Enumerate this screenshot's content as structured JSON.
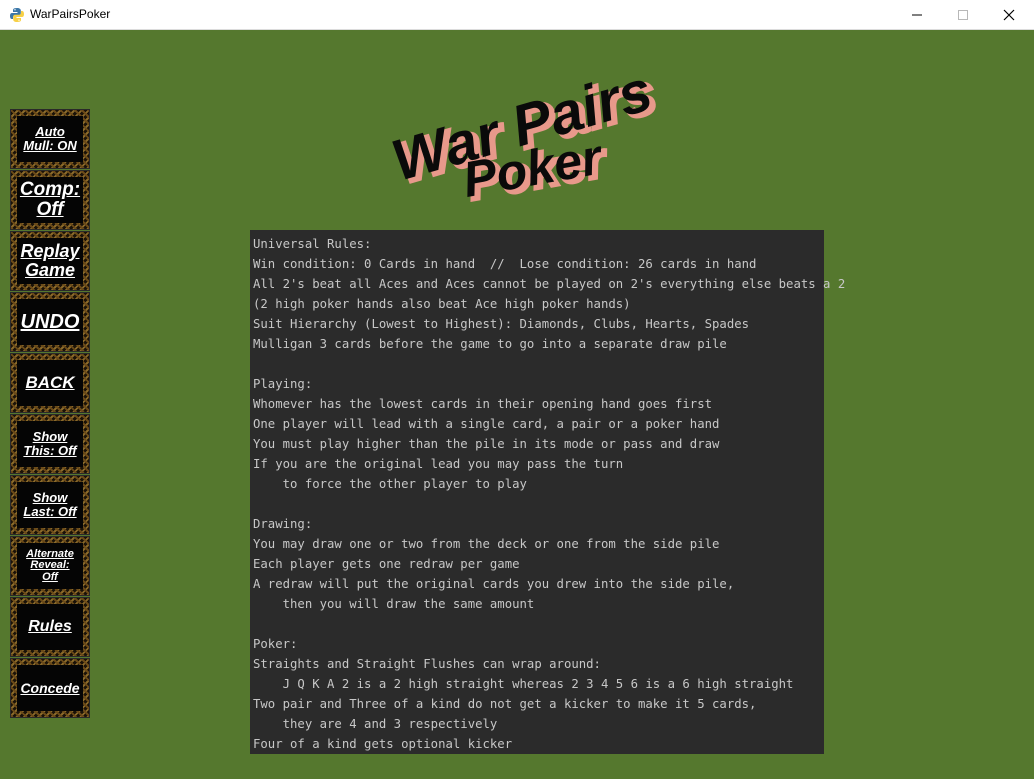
{
  "window": {
    "title": "WarPairsPoker",
    "icon": "python-icon",
    "controls": [
      "minimize-icon",
      "maximize-icon",
      "close-icon"
    ]
  },
  "logo": {
    "line1": "War Pairs",
    "line2": "Poker"
  },
  "sidebar": {
    "buttons": [
      {
        "label": "Auto\nMull: ON"
      },
      {
        "label": "Comp:\nOff"
      },
      {
        "label": "Replay\nGame"
      },
      {
        "label": "UNDO"
      },
      {
        "label": "BACK"
      },
      {
        "label": "Show\nThis: Off"
      },
      {
        "label": "Show\nLast: Off"
      },
      {
        "label": "Alternate\nReveal:\nOff"
      },
      {
        "label": "Rules"
      },
      {
        "label": "Concede"
      }
    ]
  },
  "rules": {
    "lines": [
      "Universal Rules:",
      "Win condition: 0 Cards in hand  //  Lose condition: 26 cards in hand",
      "All 2's beat all Aces and Aces cannot be played on 2's everything else beats a 2",
      "(2 high poker hands also beat Ace high poker hands)",
      "Suit Hierarchy (Lowest to Highest): Diamonds, Clubs, Hearts, Spades",
      "Mulligan 3 cards before the game to go into a separate draw pile",
      "",
      "Playing:",
      "Whomever has the lowest cards in their opening hand goes first",
      "One player will lead with a single card, a pair or a poker hand",
      "You must play higher than the pile in its mode or pass and draw",
      "If you are the original lead you may pass the turn",
      "    to force the other player to play",
      "",
      "Drawing:",
      "You may draw one or two from the deck or one from the side pile",
      "Each player gets one redraw per game",
      "A redraw will put the original cards you drew into the side pile,",
      "    then you will draw the same amount",
      "",
      "Poker:",
      "Straights and Straight Flushes can wrap around:",
      "    J Q K A 2 is a 2 high straight whereas 2 3 4 5 6 is a 6 high straight",
      "Two pair and Three of a kind do not get a kicker to make it 5 cards,",
      "    they are 4 and 3 respectively",
      "Four of a kind gets optional kicker"
    ]
  }
}
